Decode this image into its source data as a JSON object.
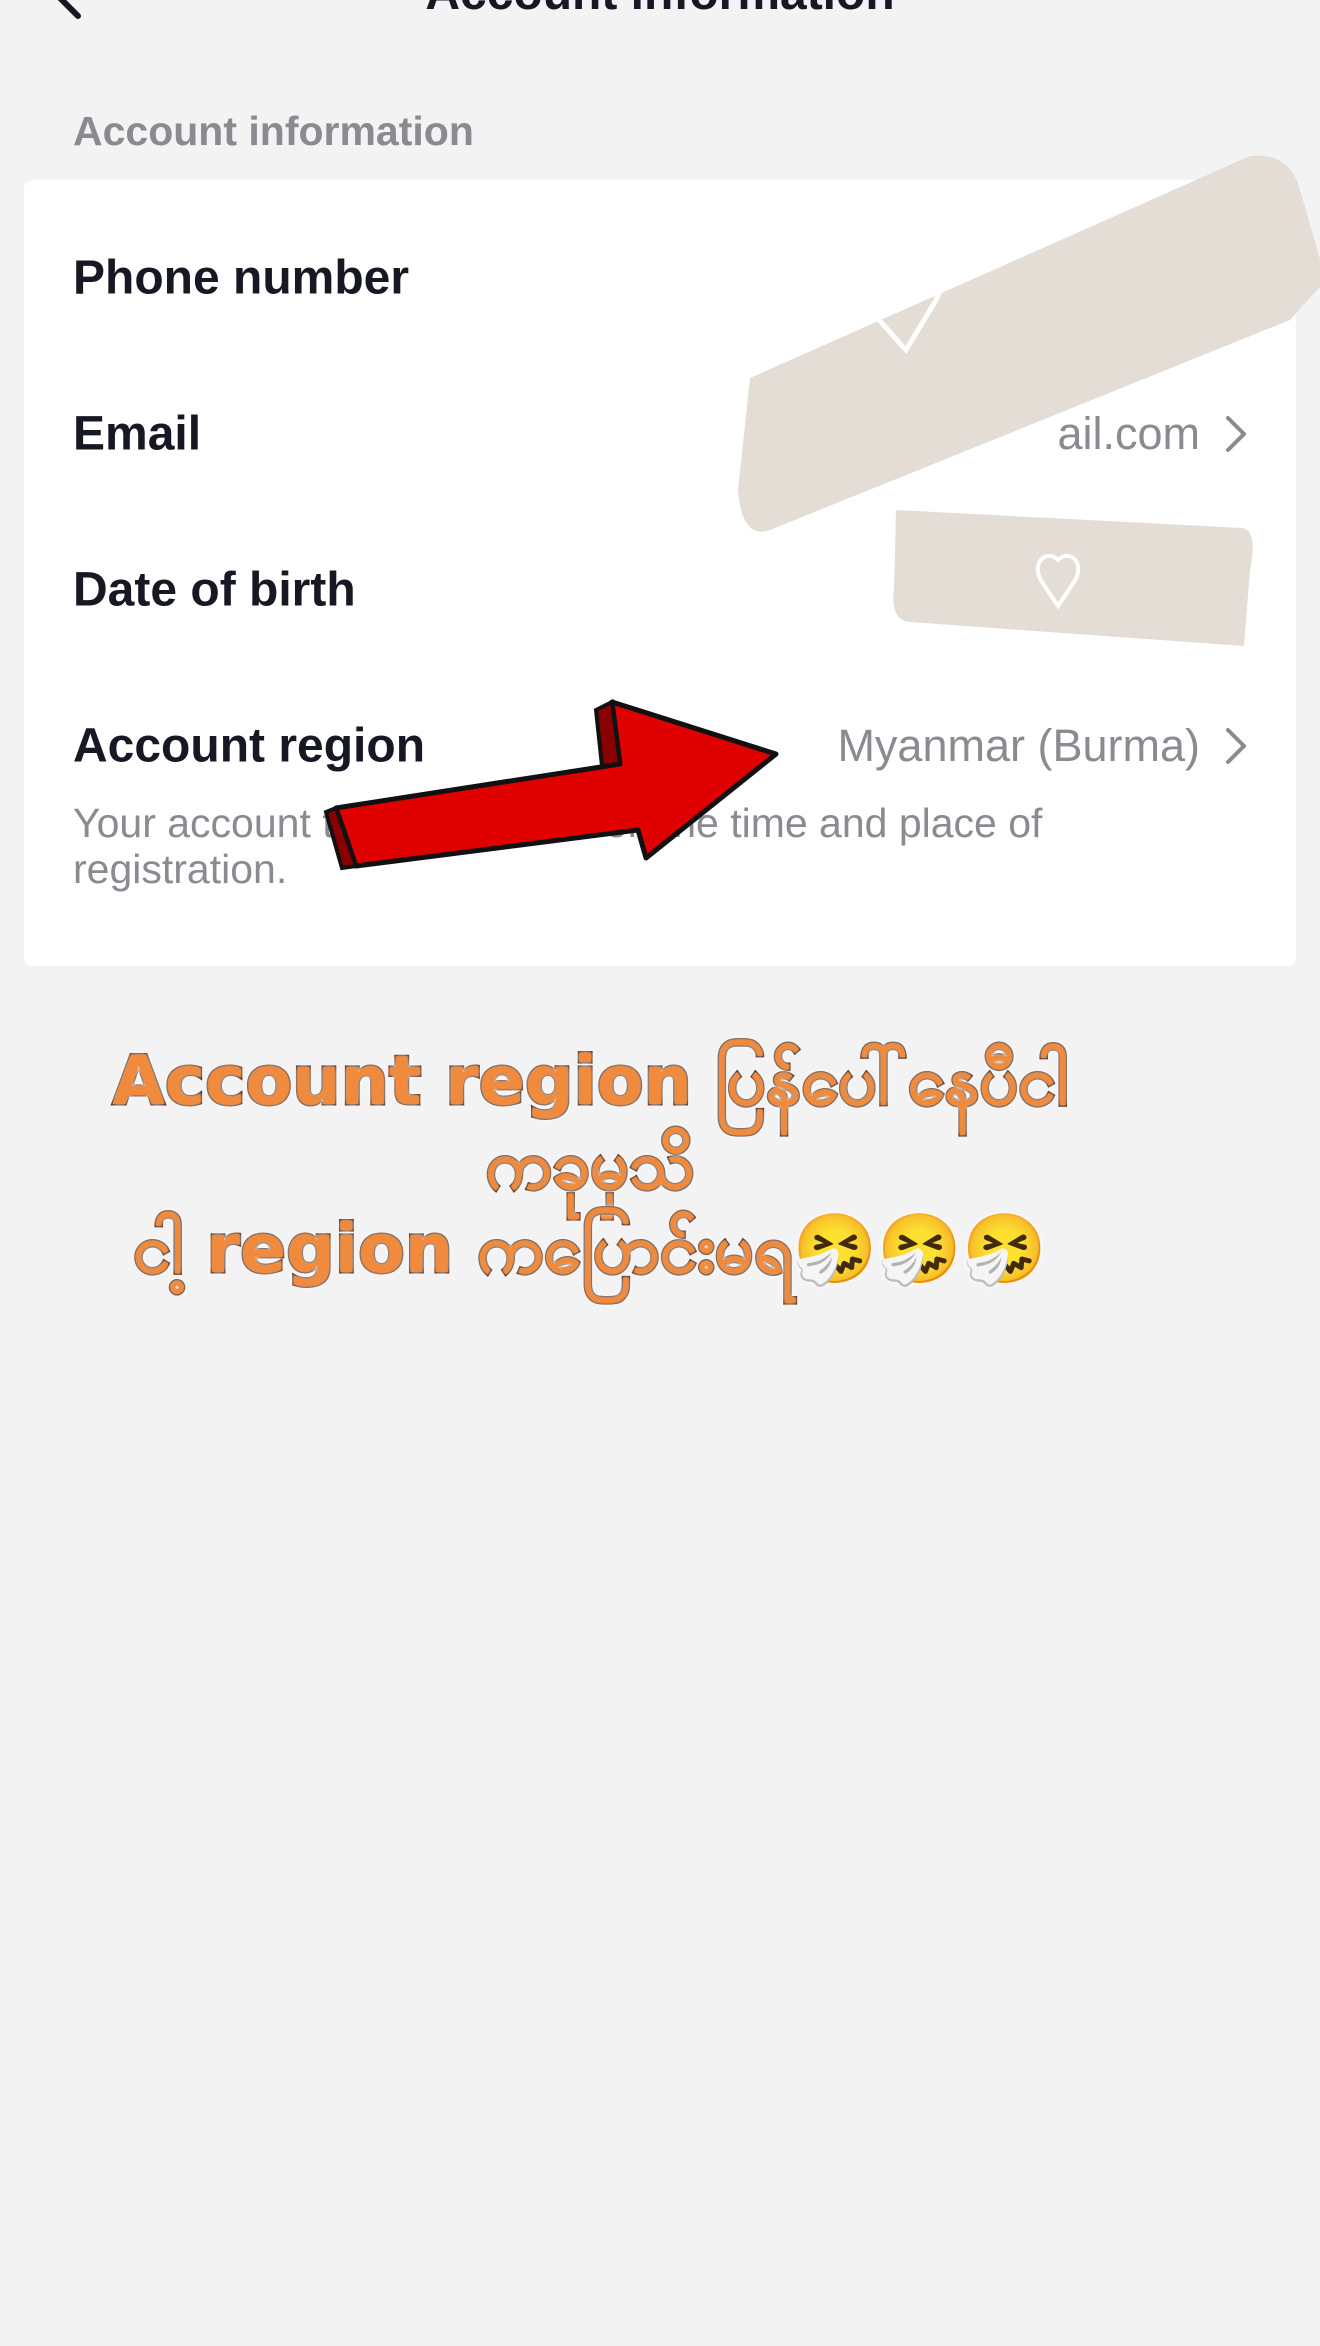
{
  "header": {
    "title": "Account information",
    "back_icon": "chevron-left-icon"
  },
  "section": {
    "label": "Account information"
  },
  "rows": [
    {
      "label": "Phone number",
      "value": ""
    },
    {
      "label": "Email",
      "value": "ail.com"
    },
    {
      "label": "Date of birth",
      "value": ""
    },
    {
      "label": "Account region",
      "value": "Myanmar (Burma)"
    }
  ],
  "region_note": "Your account tially set based on the time and place of registration.",
  "overlay": {
    "caption_lines": [
      "Account region  ပြန်ပေါ်နေပီငါ",
      "ကခုမှသိ",
      "ငါ့ region ကပြောင်းမရ🤧🤧🤧"
    ]
  },
  "colors": {
    "background": "#f3f3f3",
    "card": "#ffffff",
    "text_primary": "#161823",
    "text_secondary": "#8a8b91",
    "arrow": "#e00000",
    "caption_fill": "#f08a3c"
  }
}
